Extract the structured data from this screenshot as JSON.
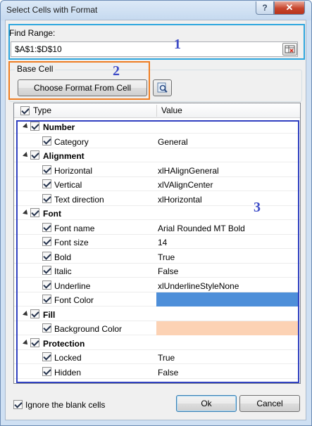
{
  "window": {
    "title": "Select Cells with Format",
    "help_glyph": "?",
    "close_glyph": "✕"
  },
  "find_range": {
    "label": "Find Range:",
    "value": "$A$1:$D$10"
  },
  "base_cell": {
    "label": "Base Cell",
    "choose_button": "Choose Format From Cell"
  },
  "tree": {
    "header": {
      "type": "Type",
      "value": "Value"
    },
    "rows": [
      {
        "name": "Number",
        "value": "",
        "group": true
      },
      {
        "name": "Category",
        "value": "General"
      },
      {
        "name": "Alignment",
        "value": "",
        "group": true
      },
      {
        "name": "Horizontal",
        "value": "xlHAlignGeneral"
      },
      {
        "name": "Vertical",
        "value": "xlVAlignCenter"
      },
      {
        "name": "Text direction",
        "value": "xlHorizontal"
      },
      {
        "name": "Font",
        "value": "",
        "group": true
      },
      {
        "name": "Font name",
        "value": "Arial Rounded MT Bold"
      },
      {
        "name": "Font size",
        "value": "14"
      },
      {
        "name": "Bold",
        "value": "True"
      },
      {
        "name": "Italic",
        "value": "False"
      },
      {
        "name": "Underline",
        "value": "xlUnderlineStyleNone"
      },
      {
        "name": "Font Color",
        "value": "",
        "color": "#4e8fd9"
      },
      {
        "name": "Fill",
        "value": "",
        "group": true
      },
      {
        "name": "Background Color",
        "value": "",
        "color": "#fcd2b4"
      },
      {
        "name": "Protection",
        "value": "",
        "group": true
      },
      {
        "name": "Locked",
        "value": "True"
      },
      {
        "name": "Hidden",
        "value": "False"
      }
    ]
  },
  "annotations": {
    "one": "1",
    "two": "2",
    "three": "3"
  },
  "footer": {
    "ignore_blank": "Ignore the blank cells",
    "ok": "Ok",
    "cancel": "Cancel"
  },
  "colors": {
    "highlight_1": "#2ea6de",
    "highlight_2": "#ef7d22",
    "highlight_3": "#3040c0"
  }
}
